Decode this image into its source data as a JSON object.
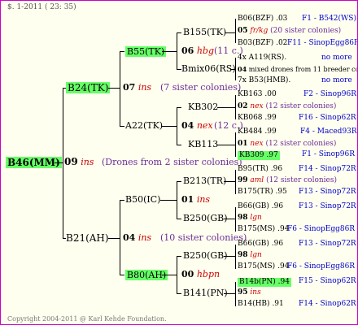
{
  "header": {
    "date": "$. 1-2011 ( 23: 35)"
  },
  "footer": {
    "copyright": "Copyright 2004-2011 @ Karl Kehde Foundation."
  },
  "root": {
    "name": "B46(MM)",
    "gen": "09",
    "code": "ins",
    "note": "(Drones from 2 sister colonies)"
  },
  "l1": {
    "upper": {
      "name": "B24(TK)",
      "gen": "07",
      "code": "ins",
      "note": "(7 sister colonies)"
    },
    "lower": {
      "name": "B21(AH)",
      "gen": "04",
      "code": "ins",
      "note": "(10 sister colonies)"
    }
  },
  "l2": {
    "b55": {
      "name": "B55(TK)",
      "gen": "06",
      "code": "hbg",
      "note": "(11 c.)"
    },
    "a22": {
      "name": "A22(TK)",
      "gen": "04",
      "code": "nex",
      "note": "(12 c.)"
    },
    "b50": {
      "name": "B50(IC)",
      "gen": "01",
      "code": "ins"
    },
    "b80": {
      "name": "B80(AH)",
      "gen": "00",
      "code": "hbpn"
    }
  },
  "l3": {
    "b155": "B155(TK)",
    "bmix": "Bmix06(RS)",
    "kb302": "KB302",
    "kb113": "KB113",
    "b213": "B213(TR)",
    "b250a": "B250(GB)",
    "b250b": "B250(GB)",
    "b141": "B141(PN)"
  },
  "l3gen": {
    "g1": {
      "gen": "05",
      "code": "fr/kg",
      "note": "(20 sister colonies)"
    },
    "g2": {
      "gen": "04",
      "note": "mixed drones from 11 breeder colonies"
    },
    "g3": {
      "gen": "02",
      "code": "nex",
      "note": "(12 sister colonies)"
    },
    "g4": {
      "gen": "01",
      "code": "nex",
      "note": "(12 sister colonies)"
    },
    "g5": {
      "gen": "99",
      "code": "aml",
      "note": "(12 sister colonies)"
    },
    "g6": {
      "gen": "98",
      "code": "lgn"
    },
    "g7": {
      "gen": "98",
      "code": "lgn"
    },
    "g8": {
      "gen": "95",
      "code": "ins"
    }
  },
  "rows": [
    {
      "name": "B06(BZF)",
      "val": ".03",
      "origin": "F1 - B542(WS)"
    },
    {
      "name": "B03(BZF)",
      "val": ".02",
      "origin": "F11 - SinopEgg86R"
    },
    {
      "name": "4x A119(RS)",
      "val": ".",
      "origin": "no more"
    },
    {
      "name": "7x B53(HMB)",
      "val": ".",
      "origin": "no more"
    },
    {
      "name": "KB163",
      "val": ".00",
      "origin": "F2 - Sinop96R"
    },
    {
      "name": "KB068",
      "val": ".99",
      "origin": "F16 - Sinop62R"
    },
    {
      "name": "KB484",
      "val": ".99",
      "origin": "F4 - Maced93R"
    },
    {
      "name": "KB309",
      "val": ".97",
      "origin": "F1 - Sinop96R"
    },
    {
      "name": "B95(TR)",
      "val": ".96",
      "origin": "F14 - Sinop72R"
    },
    {
      "name": "B175(TR)",
      "val": ".95",
      "origin": "F13 - Sinop72R"
    },
    {
      "name": "B66(GB)",
      "val": ".96",
      "origin": "F13 - Sinop72R"
    },
    {
      "name": "B175(MS)",
      "val": ".94",
      "origin": "F6 - SinopEgg86R"
    },
    {
      "name": "B66(GB)",
      "val": ".96",
      "origin": "F13 - Sinop72R"
    },
    {
      "name": "B175(MS)",
      "val": ".94",
      "origin": "F6 - SinopEgg86R"
    },
    {
      "name": "B14b(PN)",
      "val": ".94",
      "origin": "F15 - Sinop62R"
    },
    {
      "name": "B14(HB)",
      "val": ".91",
      "origin": "F14 - Sinop62R"
    }
  ]
}
